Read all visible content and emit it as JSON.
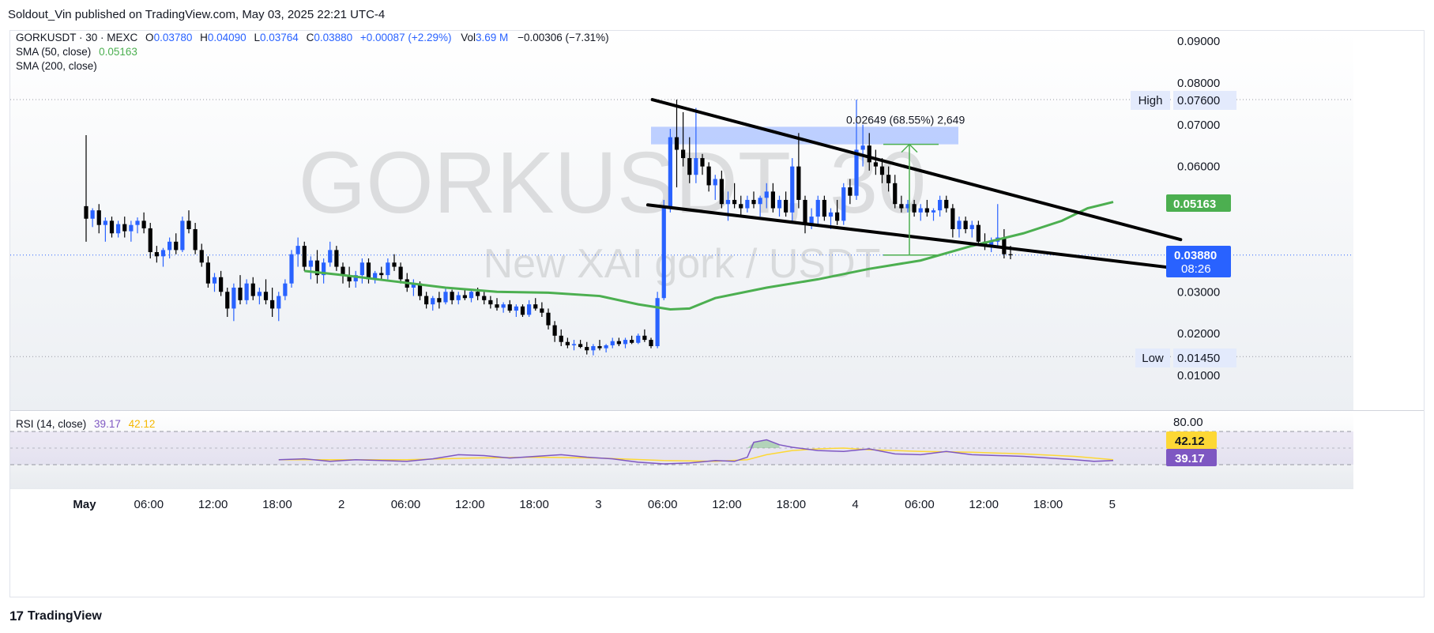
{
  "publisher_line": "Soldout_Vin published on TradingView.com, May 03, 2025 22:21 UTC-4",
  "footer": {
    "logo_icon": "tradingview-logo-icon",
    "brand": "TradingView"
  },
  "legend": {
    "symbol": "GORKUSDT · 30 · MEXC",
    "o_label": "O",
    "o_value": "0.03780",
    "h_label": "H",
    "h_value": "0.04090",
    "l_label": "L",
    "l_value": "0.03764",
    "c_label": "C",
    "c_value": "0.03880",
    "change": "+0.00087 (+2.29%)",
    "vol_label": "Vol",
    "vol_value": "3.69 M",
    "vol_change": "−0.00306 (−7.31%)",
    "sma50_label": "SMA (50, close)",
    "sma50_value": "0.05163",
    "sma200_label": "SMA (200, close)"
  },
  "watermark": {
    "line1": "GORKUSDT, 30",
    "line2": "New XAI gork / USDT"
  },
  "price_axis": {
    "ticks": [
      "0.09000",
      "0.08000",
      "0.07000",
      "0.06000",
      "0.03000",
      "0.02000",
      "0.01000"
    ],
    "high_label": "High",
    "high_value": "0.07600",
    "low_label": "Low",
    "low_value": "0.01450",
    "sma_badge": "0.05163",
    "last_price": "0.03880",
    "countdown": "08:26"
  },
  "measure_label": "0.02649 (68.55%) 2,649",
  "rsi": {
    "label": "RSI (14, close)",
    "value": "39.17",
    "ma_value": "42.12",
    "axis_tick": "80.00"
  },
  "time_axis": [
    "May",
    "06:00",
    "12:00",
    "18:00",
    "2",
    "06:00",
    "12:00",
    "18:00",
    "3",
    "06:00",
    "12:00",
    "18:00",
    "4",
    "06:00",
    "12:00",
    "18:00",
    "5"
  ],
  "colors": {
    "up": "#2962ff",
    "down": "#000000",
    "sma50": "#4caf50",
    "rsi": "#7e57c2",
    "rsi_ma": "#fdd835",
    "zone": "#b2c7ff",
    "measure": "#4caf50",
    "last_price_badge": "#2962ff"
  },
  "chart_data": {
    "type": "candlestick",
    "interval": "30m",
    "y_range": [
      0.0,
      0.095
    ],
    "high": 0.076,
    "low": 0.0145,
    "last_close": 0.0388,
    "sma50_last": 0.05163,
    "rsi_last": 39.17,
    "rsi_ma_last": 42.12,
    "measured_move": {
      "from": 0.0388,
      "to": 0.0653,
      "change": 0.02649,
      "percent": 68.55
    },
    "candles": [
      {
        "o": 0.0505,
        "h": 0.0675,
        "l": 0.042,
        "c": 0.0475
      },
      {
        "o": 0.0475,
        "h": 0.05,
        "l": 0.0455,
        "c": 0.0495
      },
      {
        "o": 0.0495,
        "h": 0.051,
        "l": 0.044,
        "c": 0.046
      },
      {
        "o": 0.046,
        "h": 0.0478,
        "l": 0.042,
        "c": 0.047
      },
      {
        "o": 0.047,
        "h": 0.048,
        "l": 0.043,
        "c": 0.044
      },
      {
        "o": 0.044,
        "h": 0.047,
        "l": 0.043,
        "c": 0.0462
      },
      {
        "o": 0.0462,
        "h": 0.048,
        "l": 0.043,
        "c": 0.0445
      },
      {
        "o": 0.0445,
        "h": 0.047,
        "l": 0.042,
        "c": 0.046
      },
      {
        "o": 0.046,
        "h": 0.0478,
        "l": 0.044,
        "c": 0.047
      },
      {
        "o": 0.047,
        "h": 0.049,
        "l": 0.044,
        "c": 0.0452
      },
      {
        "o": 0.0452,
        "h": 0.0465,
        "l": 0.038,
        "c": 0.0395
      },
      {
        "o": 0.0395,
        "h": 0.041,
        "l": 0.037,
        "c": 0.0385
      },
      {
        "o": 0.0385,
        "h": 0.0405,
        "l": 0.036,
        "c": 0.04
      },
      {
        "o": 0.04,
        "h": 0.043,
        "l": 0.038,
        "c": 0.042
      },
      {
        "o": 0.042,
        "h": 0.044,
        "l": 0.039,
        "c": 0.04
      },
      {
        "o": 0.04,
        "h": 0.048,
        "l": 0.0395,
        "c": 0.047
      },
      {
        "o": 0.047,
        "h": 0.0495,
        "l": 0.044,
        "c": 0.045
      },
      {
        "o": 0.045,
        "h": 0.0465,
        "l": 0.039,
        "c": 0.04
      },
      {
        "o": 0.04,
        "h": 0.0415,
        "l": 0.036,
        "c": 0.037
      },
      {
        "o": 0.037,
        "h": 0.0385,
        "l": 0.031,
        "c": 0.032
      },
      {
        "o": 0.032,
        "h": 0.0345,
        "l": 0.03,
        "c": 0.0335
      },
      {
        "o": 0.0335,
        "h": 0.035,
        "l": 0.029,
        "c": 0.03
      },
      {
        "o": 0.03,
        "h": 0.031,
        "l": 0.024,
        "c": 0.026
      },
      {
        "o": 0.026,
        "h": 0.032,
        "l": 0.023,
        "c": 0.031
      },
      {
        "o": 0.031,
        "h": 0.034,
        "l": 0.027,
        "c": 0.028
      },
      {
        "o": 0.028,
        "h": 0.033,
        "l": 0.027,
        "c": 0.032
      },
      {
        "o": 0.032,
        "h": 0.0335,
        "l": 0.028,
        "c": 0.029
      },
      {
        "o": 0.029,
        "h": 0.031,
        "l": 0.027,
        "c": 0.03
      },
      {
        "o": 0.03,
        "h": 0.033,
        "l": 0.027,
        "c": 0.028
      },
      {
        "o": 0.028,
        "h": 0.031,
        "l": 0.024,
        "c": 0.026
      },
      {
        "o": 0.026,
        "h": 0.03,
        "l": 0.023,
        "c": 0.029
      },
      {
        "o": 0.029,
        "h": 0.033,
        "l": 0.028,
        "c": 0.032
      },
      {
        "o": 0.032,
        "h": 0.04,
        "l": 0.031,
        "c": 0.039
      },
      {
        "o": 0.039,
        "h": 0.043,
        "l": 0.036,
        "c": 0.041
      },
      {
        "o": 0.041,
        "h": 0.042,
        "l": 0.035,
        "c": 0.036
      },
      {
        "o": 0.036,
        "h": 0.0385,
        "l": 0.033,
        "c": 0.0375
      },
      {
        "o": 0.0375,
        "h": 0.04,
        "l": 0.032,
        "c": 0.034
      },
      {
        "o": 0.034,
        "h": 0.038,
        "l": 0.032,
        "c": 0.037
      },
      {
        "o": 0.037,
        "h": 0.042,
        "l": 0.036,
        "c": 0.04
      },
      {
        "o": 0.04,
        "h": 0.041,
        "l": 0.035,
        "c": 0.036
      },
      {
        "o": 0.036,
        "h": 0.037,
        "l": 0.032,
        "c": 0.034
      },
      {
        "o": 0.034,
        "h": 0.036,
        "l": 0.031,
        "c": 0.0325
      },
      {
        "o": 0.0325,
        "h": 0.035,
        "l": 0.031,
        "c": 0.034
      },
      {
        "o": 0.034,
        "h": 0.038,
        "l": 0.032,
        "c": 0.037
      },
      {
        "o": 0.037,
        "h": 0.038,
        "l": 0.032,
        "c": 0.033
      },
      {
        "o": 0.033,
        "h": 0.035,
        "l": 0.032,
        "c": 0.0345
      },
      {
        "o": 0.0345,
        "h": 0.036,
        "l": 0.033,
        "c": 0.034
      },
      {
        "o": 0.034,
        "h": 0.038,
        "l": 0.033,
        "c": 0.037
      },
      {
        "o": 0.037,
        "h": 0.039,
        "l": 0.035,
        "c": 0.036
      },
      {
        "o": 0.036,
        "h": 0.037,
        "l": 0.032,
        "c": 0.033
      },
      {
        "o": 0.033,
        "h": 0.0345,
        "l": 0.03,
        "c": 0.031
      },
      {
        "o": 0.031,
        "h": 0.033,
        "l": 0.029,
        "c": 0.032
      },
      {
        "o": 0.032,
        "h": 0.0325,
        "l": 0.028,
        "c": 0.029
      },
      {
        "o": 0.029,
        "h": 0.03,
        "l": 0.026,
        "c": 0.027
      },
      {
        "o": 0.027,
        "h": 0.029,
        "l": 0.0255,
        "c": 0.0285
      },
      {
        "o": 0.0285,
        "h": 0.03,
        "l": 0.026,
        "c": 0.0275
      },
      {
        "o": 0.0275,
        "h": 0.031,
        "l": 0.027,
        "c": 0.03
      },
      {
        "o": 0.03,
        "h": 0.0305,
        "l": 0.027,
        "c": 0.028
      },
      {
        "o": 0.028,
        "h": 0.03,
        "l": 0.027,
        "c": 0.0292
      },
      {
        "o": 0.0292,
        "h": 0.0305,
        "l": 0.028,
        "c": 0.0285
      },
      {
        "o": 0.0285,
        "h": 0.0305,
        "l": 0.0275,
        "c": 0.03
      },
      {
        "o": 0.03,
        "h": 0.031,
        "l": 0.028,
        "c": 0.029
      },
      {
        "o": 0.029,
        "h": 0.03,
        "l": 0.027,
        "c": 0.028
      },
      {
        "o": 0.028,
        "h": 0.029,
        "l": 0.026,
        "c": 0.027
      },
      {
        "o": 0.027,
        "h": 0.0285,
        "l": 0.0255,
        "c": 0.0262
      },
      {
        "o": 0.0262,
        "h": 0.0275,
        "l": 0.025,
        "c": 0.027
      },
      {
        "o": 0.027,
        "h": 0.028,
        "l": 0.025,
        "c": 0.0255
      },
      {
        "o": 0.0255,
        "h": 0.027,
        "l": 0.024,
        "c": 0.0265
      },
      {
        "o": 0.0265,
        "h": 0.027,
        "l": 0.024,
        "c": 0.0245
      },
      {
        "o": 0.0245,
        "h": 0.028,
        "l": 0.024,
        "c": 0.027
      },
      {
        "o": 0.027,
        "h": 0.0285,
        "l": 0.0255,
        "c": 0.026
      },
      {
        "o": 0.026,
        "h": 0.0275,
        "l": 0.024,
        "c": 0.025
      },
      {
        "o": 0.025,
        "h": 0.026,
        "l": 0.021,
        "c": 0.022
      },
      {
        "o": 0.022,
        "h": 0.023,
        "l": 0.018,
        "c": 0.0195
      },
      {
        "o": 0.0195,
        "h": 0.021,
        "l": 0.017,
        "c": 0.018
      },
      {
        "o": 0.018,
        "h": 0.019,
        "l": 0.0165,
        "c": 0.0172
      },
      {
        "o": 0.0172,
        "h": 0.0185,
        "l": 0.016,
        "c": 0.0175
      },
      {
        "o": 0.0175,
        "h": 0.0185,
        "l": 0.0165,
        "c": 0.0168
      },
      {
        "o": 0.0168,
        "h": 0.018,
        "l": 0.015,
        "c": 0.016
      },
      {
        "o": 0.016,
        "h": 0.0175,
        "l": 0.0148,
        "c": 0.017
      },
      {
        "o": 0.017,
        "h": 0.0185,
        "l": 0.016,
        "c": 0.0165
      },
      {
        "o": 0.0165,
        "h": 0.0175,
        "l": 0.0155,
        "c": 0.0172
      },
      {
        "o": 0.0172,
        "h": 0.019,
        "l": 0.0165,
        "c": 0.0182
      },
      {
        "o": 0.0182,
        "h": 0.019,
        "l": 0.017,
        "c": 0.0175
      },
      {
        "o": 0.0175,
        "h": 0.019,
        "l": 0.0165,
        "c": 0.0185
      },
      {
        "o": 0.0185,
        "h": 0.0195,
        "l": 0.0175,
        "c": 0.0178
      },
      {
        "o": 0.0178,
        "h": 0.02,
        "l": 0.0175,
        "c": 0.0195
      },
      {
        "o": 0.0195,
        "h": 0.021,
        "l": 0.018,
        "c": 0.0185
      },
      {
        "o": 0.0185,
        "h": 0.019,
        "l": 0.0165,
        "c": 0.017
      },
      {
        "o": 0.017,
        "h": 0.03,
        "l": 0.0165,
        "c": 0.0285
      },
      {
        "o": 0.0285,
        "h": 0.052,
        "l": 0.028,
        "c": 0.05
      },
      {
        "o": 0.05,
        "h": 0.069,
        "l": 0.049,
        "c": 0.067
      },
      {
        "o": 0.067,
        "h": 0.076,
        "l": 0.055,
        "c": 0.064
      },
      {
        "o": 0.064,
        "h": 0.073,
        "l": 0.06,
        "c": 0.062
      },
      {
        "o": 0.062,
        "h": 0.067,
        "l": 0.056,
        "c": 0.058
      },
      {
        "o": 0.058,
        "h": 0.074,
        "l": 0.056,
        "c": 0.062
      },
      {
        "o": 0.062,
        "h": 0.063,
        "l": 0.058,
        "c": 0.06
      },
      {
        "o": 0.06,
        "h": 0.061,
        "l": 0.054,
        "c": 0.0555
      },
      {
        "o": 0.0555,
        "h": 0.058,
        "l": 0.052,
        "c": 0.057
      },
      {
        "o": 0.057,
        "h": 0.059,
        "l": 0.05,
        "c": 0.051
      },
      {
        "o": 0.051,
        "h": 0.054,
        "l": 0.047,
        "c": 0.052
      },
      {
        "o": 0.052,
        "h": 0.056,
        "l": 0.05,
        "c": 0.051
      },
      {
        "o": 0.051,
        "h": 0.053,
        "l": 0.048,
        "c": 0.05
      },
      {
        "o": 0.05,
        "h": 0.053,
        "l": 0.049,
        "c": 0.052
      },
      {
        "o": 0.052,
        "h": 0.054,
        "l": 0.05,
        "c": 0.051
      },
      {
        "o": 0.051,
        "h": 0.053,
        "l": 0.048,
        "c": 0.0525
      },
      {
        "o": 0.0525,
        "h": 0.056,
        "l": 0.05,
        "c": 0.054
      },
      {
        "o": 0.054,
        "h": 0.056,
        "l": 0.049,
        "c": 0.05
      },
      {
        "o": 0.05,
        "h": 0.053,
        "l": 0.048,
        "c": 0.052
      },
      {
        "o": 0.052,
        "h": 0.054,
        "l": 0.048,
        "c": 0.049
      },
      {
        "o": 0.049,
        "h": 0.062,
        "l": 0.047,
        "c": 0.06
      },
      {
        "o": 0.06,
        "h": 0.068,
        "l": 0.05,
        "c": 0.052
      },
      {
        "o": 0.052,
        "h": 0.053,
        "l": 0.044,
        "c": 0.046
      },
      {
        "o": 0.046,
        "h": 0.05,
        "l": 0.045,
        "c": 0.048
      },
      {
        "o": 0.048,
        "h": 0.053,
        "l": 0.046,
        "c": 0.052
      },
      {
        "o": 0.052,
        "h": 0.053,
        "l": 0.047,
        "c": 0.048
      },
      {
        "o": 0.048,
        "h": 0.05,
        "l": 0.045,
        "c": 0.049
      },
      {
        "o": 0.049,
        "h": 0.052,
        "l": 0.046,
        "c": 0.047
      },
      {
        "o": 0.047,
        "h": 0.056,
        "l": 0.046,
        "c": 0.055
      },
      {
        "o": 0.055,
        "h": 0.057,
        "l": 0.051,
        "c": 0.053
      },
      {
        "o": 0.053,
        "h": 0.076,
        "l": 0.052,
        "c": 0.064
      },
      {
        "o": 0.064,
        "h": 0.07,
        "l": 0.06,
        "c": 0.065
      },
      {
        "o": 0.065,
        "h": 0.068,
        "l": 0.059,
        "c": 0.061
      },
      {
        "o": 0.061,
        "h": 0.064,
        "l": 0.058,
        "c": 0.06
      },
      {
        "o": 0.06,
        "h": 0.062,
        "l": 0.056,
        "c": 0.058
      },
      {
        "o": 0.058,
        "h": 0.06,
        "l": 0.054,
        "c": 0.056
      },
      {
        "o": 0.056,
        "h": 0.058,
        "l": 0.05,
        "c": 0.051
      },
      {
        "o": 0.051,
        "h": 0.053,
        "l": 0.049,
        "c": 0.05
      },
      {
        "o": 0.05,
        "h": 0.052,
        "l": 0.049,
        "c": 0.051
      },
      {
        "o": 0.051,
        "h": 0.052,
        "l": 0.048,
        "c": 0.049
      },
      {
        "o": 0.049,
        "h": 0.051,
        "l": 0.047,
        "c": 0.05
      },
      {
        "o": 0.05,
        "h": 0.052,
        "l": 0.048,
        "c": 0.049
      },
      {
        "o": 0.049,
        "h": 0.05,
        "l": 0.047,
        "c": 0.0495
      },
      {
        "o": 0.0495,
        "h": 0.053,
        "l": 0.048,
        "c": 0.052
      },
      {
        "o": 0.052,
        "h": 0.053,
        "l": 0.049,
        "c": 0.05
      },
      {
        "o": 0.05,
        "h": 0.051,
        "l": 0.043,
        "c": 0.045
      },
      {
        "o": 0.045,
        "h": 0.048,
        "l": 0.043,
        "c": 0.047
      },
      {
        "o": 0.047,
        "h": 0.048,
        "l": 0.044,
        "c": 0.045
      },
      {
        "o": 0.045,
        "h": 0.047,
        "l": 0.043,
        "c": 0.046
      },
      {
        "o": 0.046,
        "h": 0.047,
        "l": 0.041,
        "c": 0.042
      },
      {
        "o": 0.042,
        "h": 0.044,
        "l": 0.04,
        "c": 0.041
      },
      {
        "o": 0.041,
        "h": 0.043,
        "l": 0.0395,
        "c": 0.042
      },
      {
        "o": 0.042,
        "h": 0.051,
        "l": 0.041,
        "c": 0.043
      },
      {
        "o": 0.043,
        "h": 0.045,
        "l": 0.038,
        "c": 0.039
      },
      {
        "o": 0.039,
        "h": 0.041,
        "l": 0.0378,
        "c": 0.0388
      }
    ],
    "sma50": [
      [
        34,
        0.035
      ],
      [
        40,
        0.034
      ],
      [
        48,
        0.0325
      ],
      [
        56,
        0.031
      ],
      [
        64,
        0.03
      ],
      [
        72,
        0.0298
      ],
      [
        80,
        0.029
      ],
      [
        86,
        0.027
      ],
      [
        91,
        0.0258
      ],
      [
        94,
        0.026
      ],
      [
        98,
        0.0285
      ],
      [
        106,
        0.031
      ],
      [
        114,
        0.033
      ],
      [
        122,
        0.0355
      ],
      [
        130,
        0.0375
      ],
      [
        138,
        0.041
      ],
      [
        146,
        0.044
      ],
      [
        152,
        0.047
      ],
      [
        156,
        0.05
      ],
      [
        160,
        0.0515
      ]
    ],
    "rsi_series": [
      [
        30,
        46
      ],
      [
        34,
        47
      ],
      [
        38,
        44
      ],
      [
        42,
        46
      ],
      [
        46,
        45
      ],
      [
        50,
        44
      ],
      [
        54,
        47
      ],
      [
        58,
        52
      ],
      [
        62,
        51
      ],
      [
        66,
        48
      ],
      [
        70,
        50
      ],
      [
        74,
        52
      ],
      [
        78,
        49
      ],
      [
        82,
        47
      ],
      [
        86,
        43
      ],
      [
        90,
        41
      ],
      [
        94,
        42
      ],
      [
        98,
        45
      ],
      [
        101,
        44
      ],
      [
        103,
        49
      ],
      [
        104,
        67
      ],
      [
        106,
        70
      ],
      [
        108,
        64
      ],
      [
        110,
        61
      ],
      [
        114,
        57
      ],
      [
        118,
        56
      ],
      [
        122,
        59
      ],
      [
        126,
        53
      ],
      [
        130,
        52
      ],
      [
        134,
        56
      ],
      [
        138,
        52
      ],
      [
        142,
        51
      ],
      [
        146,
        50
      ],
      [
        150,
        48
      ],
      [
        154,
        46
      ],
      [
        157,
        44
      ],
      [
        160,
        45
      ]
    ],
    "rsi_ma_series": [
      [
        30,
        46
      ],
      [
        40,
        46
      ],
      [
        50,
        46
      ],
      [
        60,
        48
      ],
      [
        70,
        49
      ],
      [
        80,
        48
      ],
      [
        90,
        45
      ],
      [
        98,
        44
      ],
      [
        103,
        46
      ],
      [
        106,
        52
      ],
      [
        110,
        57
      ],
      [
        114,
        59
      ],
      [
        118,
        60
      ],
      [
        122,
        58
      ],
      [
        130,
        56
      ],
      [
        138,
        55
      ],
      [
        146,
        53
      ],
      [
        154,
        50
      ],
      [
        160,
        46
      ]
    ]
  }
}
